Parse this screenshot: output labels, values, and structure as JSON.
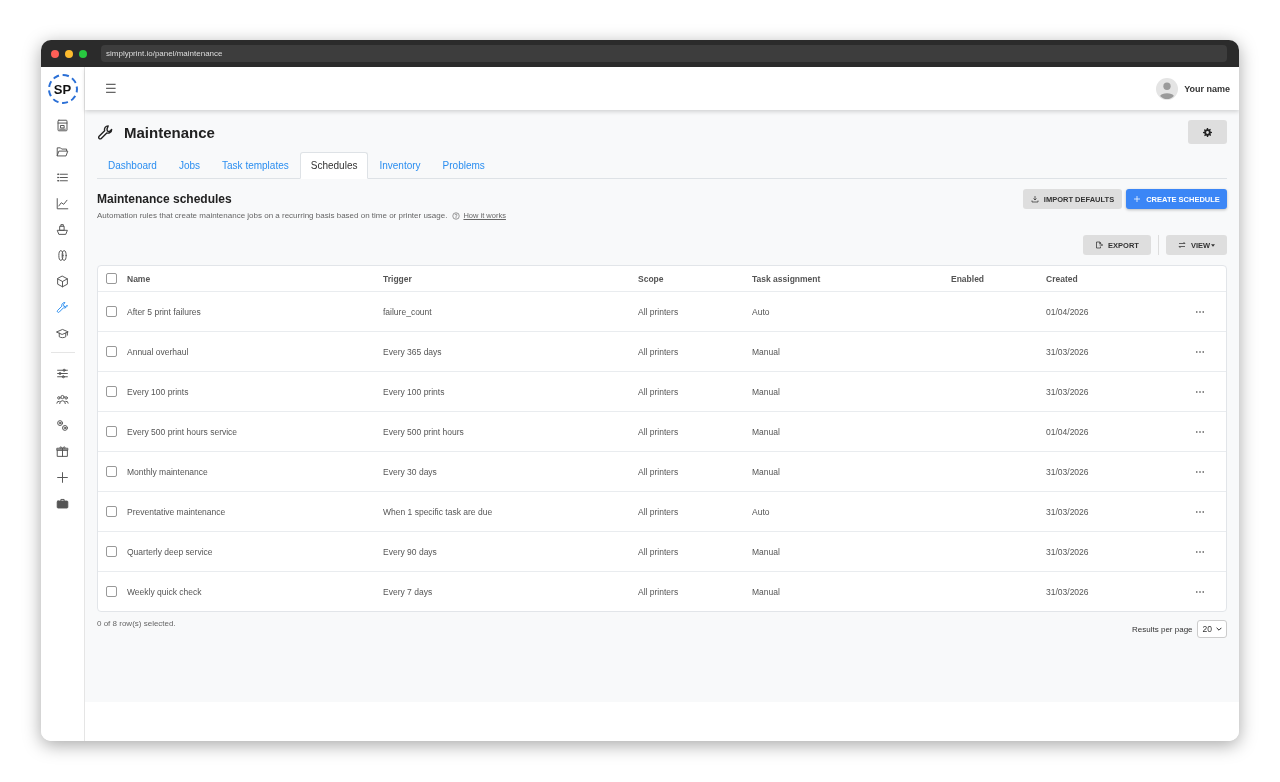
{
  "browser": {
    "url": "simplyprint.io/panel/maintenance"
  },
  "sidebar": {
    "logo": "SP",
    "items": [
      {
        "selected": false
      },
      {
        "selected": false
      },
      {
        "selected": false
      },
      {
        "selected": false
      },
      {
        "selected": false
      },
      {
        "selected": false
      },
      {
        "selected": false
      },
      {
        "selected": true
      },
      {
        "selected": false
      },
      {
        "selected": false
      },
      {
        "selected": false
      },
      {
        "selected": false
      },
      {
        "selected": false
      },
      {
        "selected": false
      },
      {
        "selected": false
      }
    ]
  },
  "header": {
    "menu_icon": "☰",
    "user_name": "Your name"
  },
  "page": {
    "title": "Maintenance"
  },
  "tabs": [
    {
      "label": "Dashboard",
      "selected": false
    },
    {
      "label": "Jobs",
      "selected": false
    },
    {
      "label": "Task templates",
      "selected": false
    },
    {
      "label": "Schedules",
      "selected": true
    },
    {
      "label": "Inventory",
      "selected": false
    },
    {
      "label": "Problems",
      "selected": false
    }
  ],
  "section": {
    "title": "Maintenance schedules",
    "description": "Automation rules that create maintenance jobs on a recurring basis based on time or printer usage.",
    "help_link": "How it works",
    "import_button": "IMPORT DEFAULTS",
    "create_button": "CREATE SCHEDULE",
    "export_button": "EXPORT",
    "view_button": "VIEW"
  },
  "table": {
    "columns": [
      "Name",
      "Trigger",
      "Scope",
      "Task assignment",
      "Enabled",
      "Created"
    ],
    "all_checked": false,
    "rows": [
      {
        "checked": false,
        "name": "After 5 print failures",
        "trigger": "failure_count",
        "scope": "All printers",
        "assignment": "Auto",
        "created": "01/04/2026"
      },
      {
        "checked": false,
        "name": "Annual overhaul",
        "trigger": "Every 365 days",
        "scope": "All printers",
        "assignment": "Manual",
        "created": "31/03/2026"
      },
      {
        "checked": false,
        "name": "Every 100 prints",
        "trigger": "Every 100 prints",
        "scope": "All printers",
        "assignment": "Manual",
        "created": "31/03/2026"
      },
      {
        "checked": false,
        "name": "Every 500 print hours service",
        "trigger": "Every 500 print hours",
        "scope": "All printers",
        "assignment": "Manual",
        "created": "01/04/2026"
      },
      {
        "checked": false,
        "name": "Monthly maintenance",
        "trigger": "Every 30 days",
        "scope": "All printers",
        "assignment": "Manual",
        "created": "31/03/2026"
      },
      {
        "checked": false,
        "name": "Preventative maintenance",
        "trigger": "When 1 specific task are due",
        "scope": "All printers",
        "assignment": "Auto",
        "created": "31/03/2026"
      },
      {
        "checked": false,
        "name": "Quarterly deep service",
        "trigger": "Every 90 days",
        "scope": "All printers",
        "assignment": "Manual",
        "created": "31/03/2026"
      },
      {
        "checked": false,
        "name": "Weekly quick check",
        "trigger": "Every 7 days",
        "scope": "All printers",
        "assignment": "Manual",
        "created": "31/03/2026"
      }
    ]
  },
  "footer": {
    "selection": "0 of 8 row(s) selected.",
    "per_page_label": "Results per page",
    "per_page": "20"
  }
}
